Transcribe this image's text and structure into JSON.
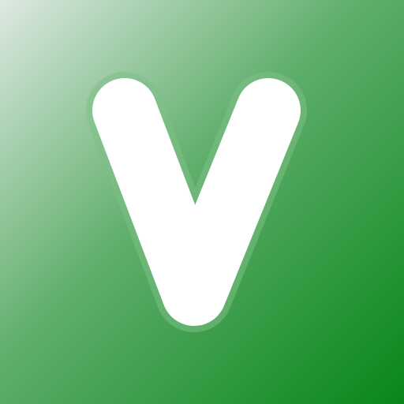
{
  "app_icon": {
    "name": "v-logo-icon",
    "glyph": "V",
    "colors": {
      "gradient_light": "#dde9e1",
      "gradient_mid": "#5fae6b",
      "gradient_dark": "#08861a",
      "glyph_fill": "#ffffff",
      "glyph_halo": "#7dbf86"
    }
  }
}
